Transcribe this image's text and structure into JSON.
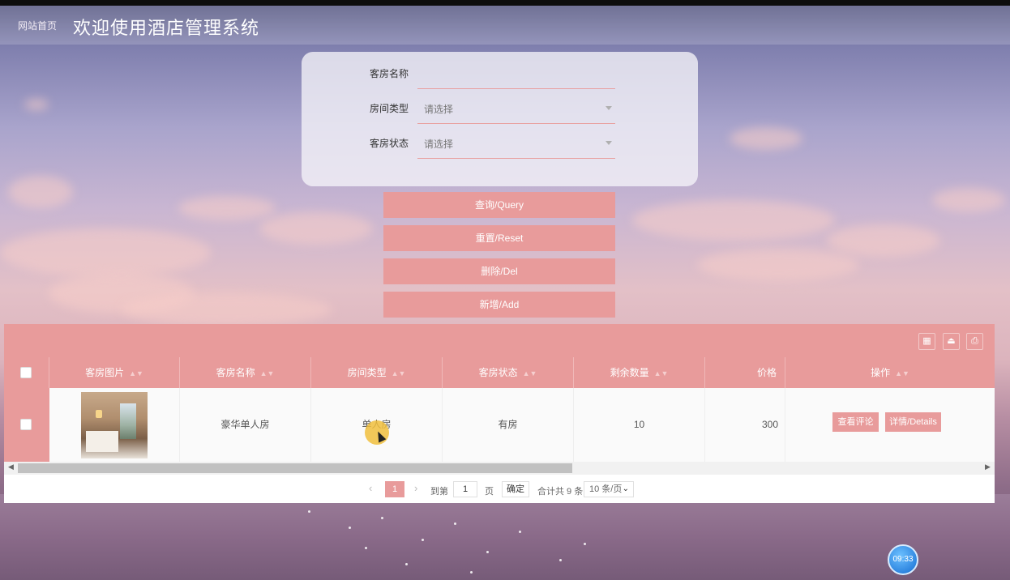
{
  "header": {
    "home_link": "网站首页",
    "title": "欢迎使用酒店管理系统"
  },
  "search": {
    "room_name_label": "客房名称",
    "room_name_value": "",
    "room_type_label": "房间类型",
    "room_type_placeholder": "请选择",
    "room_status_label": "客房状态",
    "room_status_placeholder": "请选择"
  },
  "actions": {
    "query": "查询/Query",
    "reset": "重置/Reset",
    "delete": "删除/Del",
    "add": "新增/Add"
  },
  "toolbar_icons": [
    "grid-icon",
    "export-icon",
    "print-icon"
  ],
  "table": {
    "columns": [
      "客房图片",
      "客房名称",
      "房间类型",
      "客房状态",
      "剩余数量",
      "价格",
      "操作"
    ],
    "rows": [
      {
        "room_name": "豪华单人房",
        "room_type": "单人房",
        "status": "有房",
        "remaining": "10",
        "price": "300",
        "btn_reviews": "查看评论",
        "btn_details": "详情/Details"
      }
    ]
  },
  "pager": {
    "current": "1",
    "goto_label": "到第",
    "goto_value": "1",
    "page_unit": "页",
    "confirm": "确定",
    "total": "合计共 9 条",
    "page_size": "10 条/页"
  },
  "clock": "09:33",
  "colors": {
    "accent": "#e89b9b",
    "header_text": "#ffffff"
  }
}
